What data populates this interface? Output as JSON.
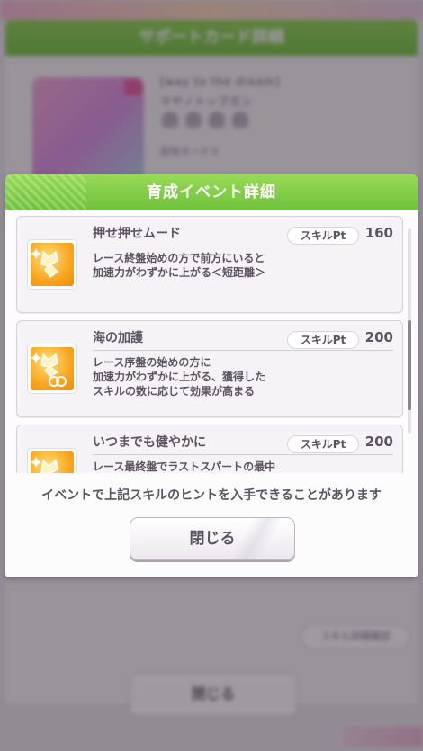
{
  "background": {
    "header_title": "サポートカード詳細",
    "card_name_line1": "[way to the dream]",
    "card_name_line2": "マヤノトップガン",
    "bonus_label": "固有ボーナス",
    "small_button_label": "スキル詳細確認",
    "close_label": "閉じる"
  },
  "modal": {
    "title": "育成イベント詳細",
    "pt_label": "スキルPt",
    "skills": [
      {
        "name": "押せ押せムード",
        "pt": "160",
        "icon": "speed-up-icon",
        "desc": [
          "レース終盤始めの方で前方にいると",
          "加速力がわずかに上がる＜短距離＞"
        ]
      },
      {
        "name": "海の加護",
        "pt": "200",
        "icon": "acceleration-icon",
        "desc": [
          "レース序盤の始めの方に",
          "加速力がわずかに上がる、獲得した",
          "スキルの数に応じて効果が高まる"
        ]
      },
      {
        "name": "いつまでも健やかに",
        "pt": "200",
        "icon": "speed-up-icon",
        "desc": [
          "レース最終盤でラストスパートの最中"
        ]
      }
    ],
    "notice": "イベントで上記スキルのヒントを入手できることがあります",
    "close_label": "閉じる"
  },
  "colors": {
    "header_green": "#7cc943",
    "text_dark": "#5d5462",
    "icon_orange": "#f9a520"
  }
}
